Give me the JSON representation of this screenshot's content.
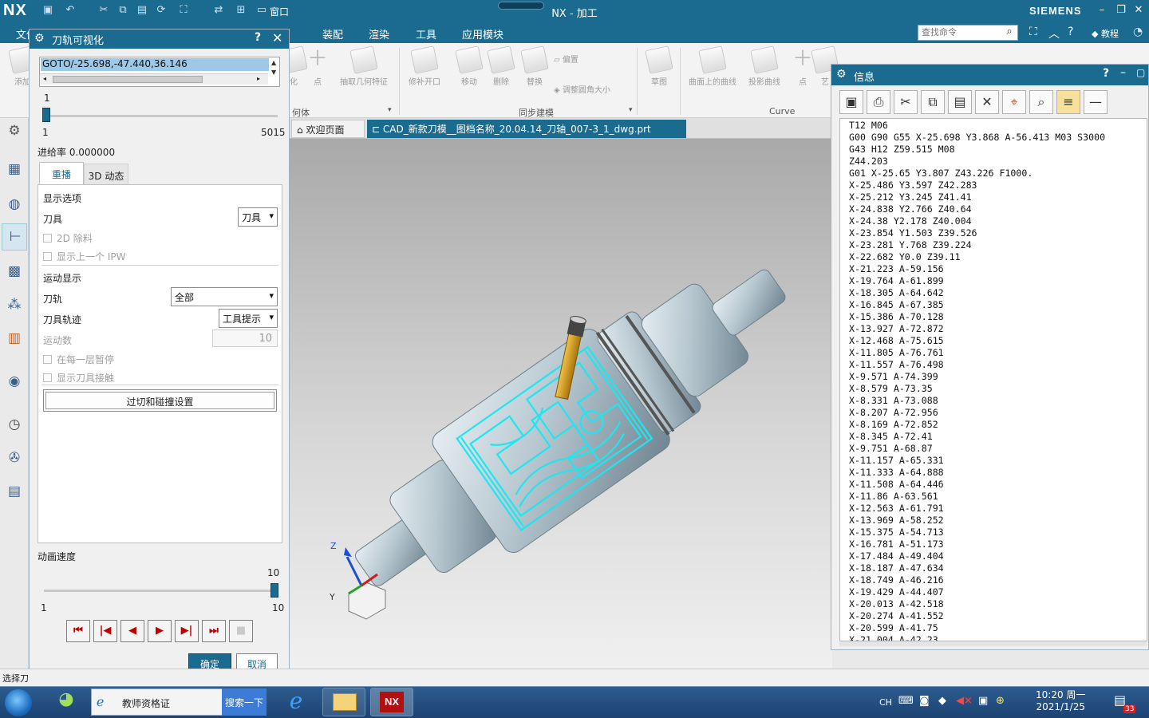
{
  "app": {
    "logo": "NX",
    "title": "NX - 加工",
    "brand": "SIEMENS",
    "window_menu": "窗口"
  },
  "menu": {
    "items": [
      "文件",
      "装配",
      "渲染",
      "工具",
      "应用模块"
    ],
    "search_placeholder": "查找命令",
    "tutorial": "教程"
  },
  "ribbon": {
    "buttons": [
      {
        "label": "添加"
      },
      {
        "label": "化"
      },
      {
        "label": "点"
      },
      {
        "label": "抽取几何特征"
      },
      {
        "label": "修补开口"
      },
      {
        "label": "移动"
      },
      {
        "label": "删除"
      },
      {
        "label": "替换"
      },
      {
        "label": "偏置"
      },
      {
        "label": "调整圆角大小"
      },
      {
        "label": "草图"
      },
      {
        "label": "曲面上的曲线"
      },
      {
        "label": "投影曲线"
      },
      {
        "label": "点"
      },
      {
        "label": "艺"
      }
    ],
    "groups": {
      "geometry": "何体",
      "sync": "同步建模",
      "curve": "Curve"
    }
  },
  "tabs": {
    "welcome": "欢迎页面",
    "cad": "CAD_新款刀模__图档名称_20.04.14_刀轴_007-3_1_dwg.prt"
  },
  "dialog": {
    "title": "刀轨可视化",
    "goto_value": "GOTO/-25.698,-47.440,36.146",
    "slider": {
      "top_label": "1",
      "min_label": "1",
      "max_label": "5015",
      "fraction": 0.0
    },
    "feed_rate": "进给率 0.000000",
    "tabs": [
      "重播",
      "3D 动态"
    ],
    "display_options": {
      "heading": "显示选项",
      "tool_label": "刀具",
      "tool_value": "刀具",
      "check_2d": "2D 除料",
      "check_ipw": "显示上一个 IPW"
    },
    "motion_display": {
      "heading": "运动显示",
      "path_label": "刀轨",
      "path_value": "全部",
      "trace_label": "刀具轨迹",
      "trace_value": "工具提示",
      "count_label": "运动数",
      "count_value": "10",
      "check_pause": "在每一层暂停",
      "check_contact": "显示刀具接触"
    },
    "overcut_button": "过切和碰撞设置",
    "anim": {
      "label": "动画速度",
      "max_top": "10",
      "min": "1",
      "max": "10",
      "fraction": 1.0
    },
    "ok": "确定",
    "cancel": "取消"
  },
  "info": {
    "title": "信息",
    "lines": [
      "T12 M06",
      "G00 G90 G55 X-25.698 Y3.868 A-56.413 M03 S3000",
      "G43 H12 Z59.515 M08",
      "Z44.203",
      "G01 X-25.65 Y3.807 Z43.226 F1000.",
      "X-25.486 Y3.597 Z42.283",
      "X-25.212 Y3.245 Z41.41",
      "X-24.838 Y2.766 Z40.64",
      "X-24.38 Y2.178 Z40.004",
      "X-23.854 Y1.503 Z39.526",
      "X-23.281 Y.768 Z39.224",
      "X-22.682 Y0.0 Z39.11",
      "X-21.223 A-59.156",
      "X-19.764 A-61.899",
      "X-18.305 A-64.642",
      "X-16.845 A-67.385",
      "X-15.386 A-70.128",
      "X-13.927 A-72.872",
      "X-12.468 A-75.615",
      "X-11.805 A-76.761",
      "X-11.557 A-76.498",
      "X-9.571 A-74.399",
      "X-8.579 A-73.35",
      "X-8.331 A-73.088",
      "X-8.207 A-72.956",
      "X-8.169 A-72.852",
      "X-8.345 A-72.41",
      "X-9.751 A-68.87",
      "X-11.157 A-65.331",
      "X-11.333 A-64.888",
      "X-11.508 A-64.446",
      "X-11.86 A-63.561",
      "X-12.563 A-61.791",
      "X-13.969 A-58.252",
      "X-15.375 A-54.713",
      "X-16.781 A-51.173",
      "X-17.484 A-49.404",
      "X-18.187 A-47.634",
      "X-18.749 A-46.216",
      "X-19.429 A-44.407",
      "X-20.013 A-42.518",
      "X-20.274 A-41.552",
      "X-20.599 A-41.75",
      "X-21.004 A-42.23"
    ]
  },
  "status": {
    "text": "选择刀"
  },
  "taskbar": {
    "search_text": "教师资格证",
    "search_button": "搜索一下",
    "nx_label": "NX",
    "lang": "CH",
    "time": "10:20 周一",
    "date": "2021/1/25",
    "badge": "33"
  },
  "axes": {
    "z": "Z",
    "y": "Y"
  },
  "colors": {
    "accent": "#1b6a8f",
    "toolpath": "#1ee6f0",
    "tool": "#d9a21a",
    "part": "#aebfc9"
  }
}
